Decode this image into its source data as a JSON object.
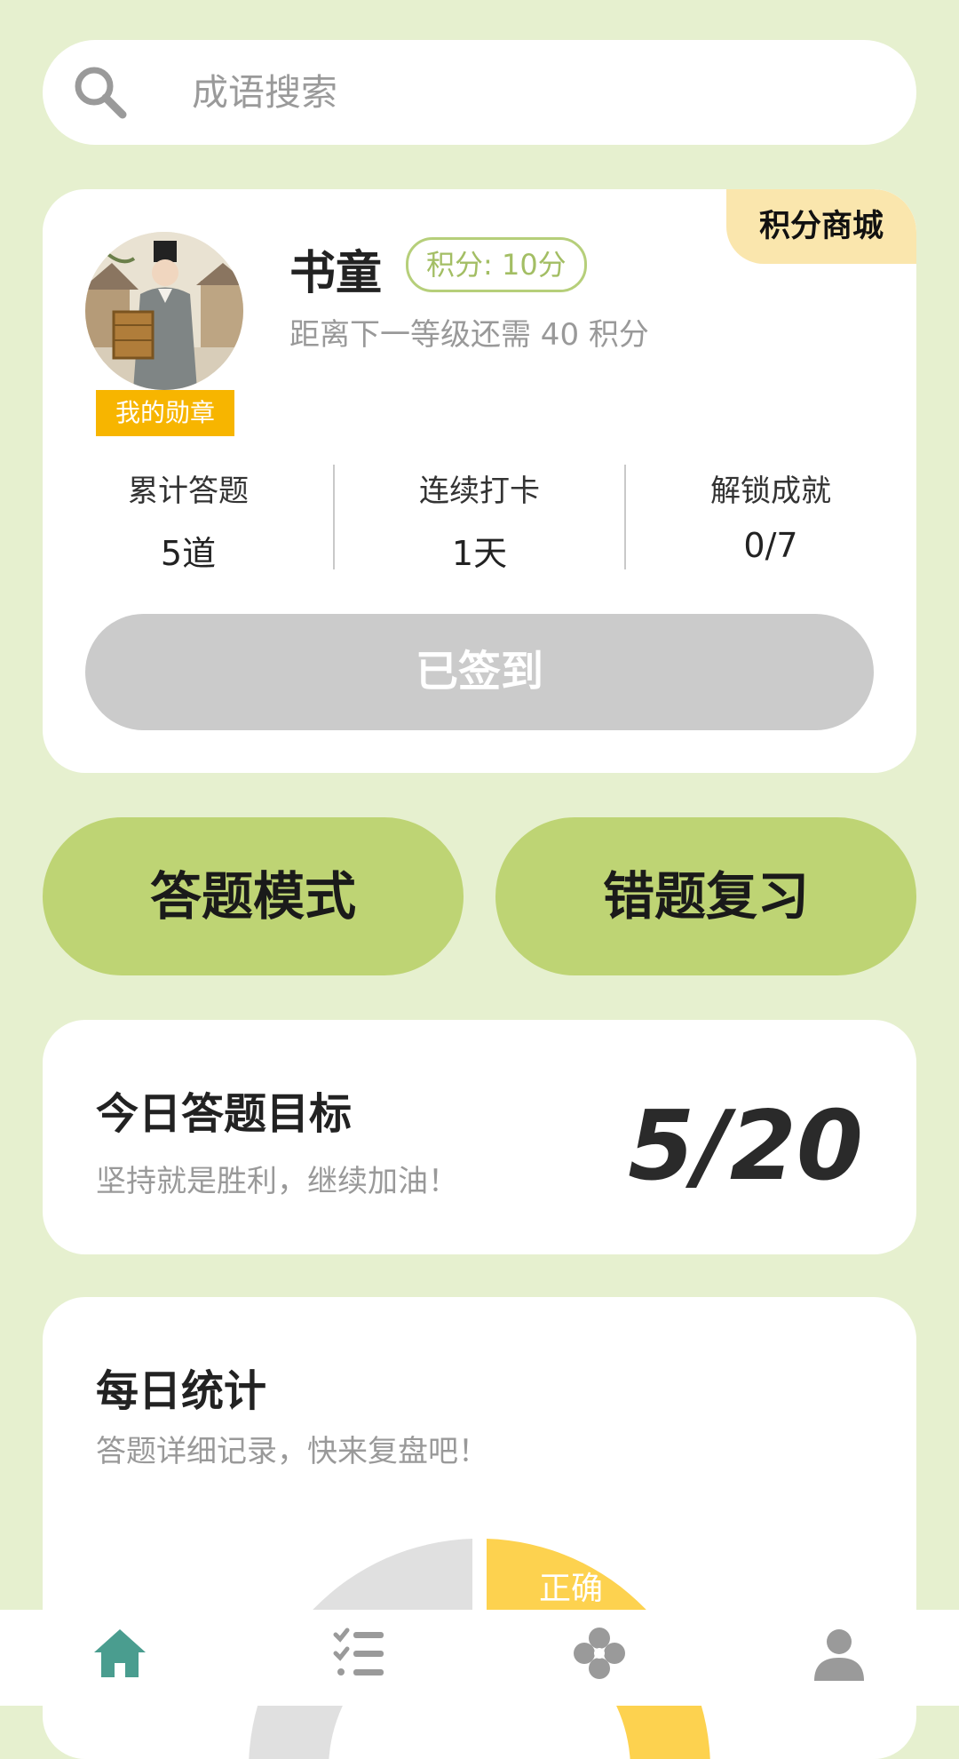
{
  "search": {
    "placeholder": "成语搜索",
    "icon": "search-icon"
  },
  "profile": {
    "mall_label": "积分商城",
    "name": "书童",
    "points": "积分: 10分",
    "level_hint": "距离下一等级还需 40 积分",
    "medal_label": "我的勋章",
    "stats": [
      {
        "label": "累计答题",
        "value": "5道"
      },
      {
        "label": "连续打卡",
        "value": "1天"
      },
      {
        "label": "解锁成就",
        "value": "0/7"
      }
    ],
    "checkin_label": "已签到"
  },
  "modes": {
    "answer_label": "答题模式",
    "review_label": "错题复习"
  },
  "goal": {
    "title": "今日答题目标",
    "subtitle": "坚持就是胜利，继续加油！",
    "value": "5/20"
  },
  "daily": {
    "title": "每日统计",
    "subtitle": "答题详细记录，快来复盘吧！",
    "correct_label": "正确"
  },
  "colors": {
    "accent_green": "#bed474",
    "background": "#e6f0cf",
    "gold": "#f7b500",
    "chart_correct": "#fdd24f",
    "chart_other": "#e0e0e0",
    "nav_active": "#4a9d8f",
    "nav_inactive": "#9a9a9a"
  },
  "nav": [
    {
      "icon": "home-icon",
      "active": true
    },
    {
      "icon": "checklist-icon",
      "active": false
    },
    {
      "icon": "clover-icon",
      "active": false
    },
    {
      "icon": "user-icon",
      "active": false
    }
  ]
}
